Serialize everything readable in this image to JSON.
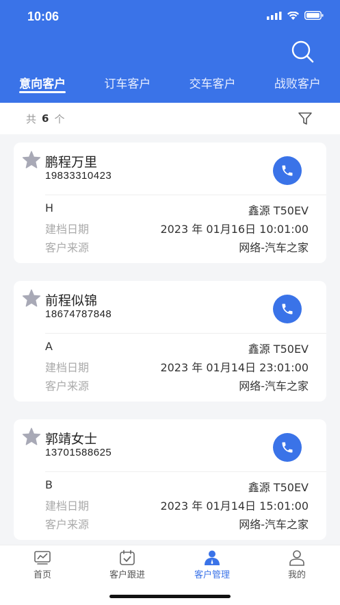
{
  "status": {
    "time": "10:06"
  },
  "tabs": [
    {
      "label": "意向客户",
      "active": true
    },
    {
      "label": "订车客户",
      "active": false
    },
    {
      "label": "交车客户",
      "active": false
    },
    {
      "label": "战败客户",
      "active": false
    }
  ],
  "count": {
    "prefix": "共",
    "number": "6",
    "suffix": "个"
  },
  "customers": [
    {
      "name": "鹏程万里",
      "phone": "19833310423",
      "level": "H",
      "car": "鑫源 T50EV",
      "date_label": "建档日期",
      "date": "2023 年 01月16日 10:01:00",
      "source_label": "客户来源",
      "source": "网络-汽车之家"
    },
    {
      "name": "前程似锦",
      "phone": "18674787848",
      "level": "A",
      "car": "鑫源 T50EV",
      "date_label": "建档日期",
      "date": "2023 年 01月14日 23:01:00",
      "source_label": "客户来源",
      "source": "网络-汽车之家"
    },
    {
      "name": "郭靖女士",
      "phone": "13701588625",
      "level": "B",
      "car": "鑫源 T50EV",
      "date_label": "建档日期",
      "date": "2023 年 01月14日 15:01:00",
      "source_label": "客户来源",
      "source": "网络-汽车之家"
    }
  ],
  "tabbar": [
    {
      "label": "首页",
      "icon": "chart-icon",
      "active": false
    },
    {
      "label": "客户跟进",
      "icon": "calendar-check-icon",
      "active": false
    },
    {
      "label": "客户管理",
      "icon": "person-icon",
      "active": true
    },
    {
      "label": "我的",
      "icon": "profile-icon",
      "active": false
    }
  ],
  "colors": {
    "primary": "#3a73e8",
    "star": "#a8a9b6"
  }
}
